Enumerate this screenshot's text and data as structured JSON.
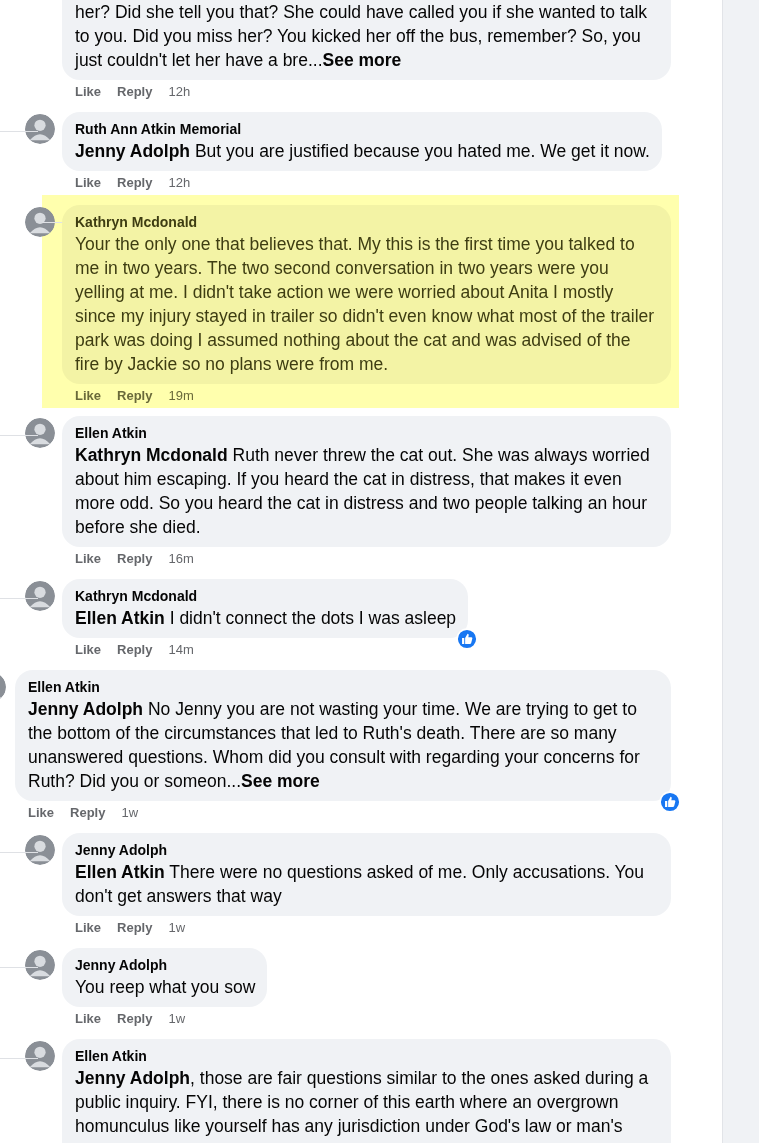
{
  "earlier_replies": [
    {
      "kind": "partial",
      "text": "her? Did she tell you that? She could have called you if she wanted to talk to you. Did you miss her? You kicked her off the bus, remember? So, you just couldn't let her have a bre...",
      "see_more": "See more",
      "like": "Like",
      "reply": "Reply",
      "time": "12h",
      "highlighted": false,
      "reacted": false
    },
    {
      "kind": "full",
      "author": "Ruth Ann Atkin Memorial",
      "text": "**Jenny Adolph** But you are justified because you hated me. We get it now.",
      "like": "Like",
      "reply": "Reply",
      "time": "12h",
      "highlighted": false,
      "reacted": false
    },
    {
      "kind": "full",
      "author": "Kathryn Mcdonald",
      "text": "Your the only one that believes that. My this is the first time you talked to me in two years. The two second conversation in two years were you yelling at me. I didn't take action we were worried about Anita I mostly since my injury stayed in trailer so didn't even know what most of the trailer park was doing I assumed nothing about the cat and was advised of the fire by Jackie so no plans were from me.",
      "like": "Like",
      "reply": "Reply",
      "time": "19m",
      "highlighted": true,
      "reacted": false
    },
    {
      "kind": "full",
      "author": "Ellen Atkin",
      "text": "**Kathryn Mcdonald** Ruth never threw the cat out. She was always worried about him escaping. If you heard the cat in distress, that makes it even more odd. So you heard the cat in distress and two people talking an hour before she died.",
      "like": "Like",
      "reply": "Reply",
      "time": "16m",
      "highlighted": false,
      "reacted": false
    },
    {
      "kind": "full",
      "author": "Kathryn Mcdonald",
      "text": "**Ellen Atkin** I didn't connect the dots I was asleep",
      "like": "Like",
      "reply": "Reply",
      "time": "14m",
      "highlighted": false,
      "reacted": true
    }
  ],
  "comment": {
    "kind": "full",
    "author": "Ellen Atkin",
    "text": "**Jenny Adolph** No Jenny you are not wasting your time. We are trying to get to the bottom of the circumstances that led to Ruth's death. There are so many unanswered questions. Whom did you consult with regarding your concerns for Ruth? Did you or someon...",
    "see_more": "See more",
    "like": "Like",
    "reply": "Reply",
    "time": "1w",
    "highlighted": false,
    "reacted": true,
    "children": [
      {
        "kind": "full",
        "author": "Jenny Adolph",
        "text": "**Ellen Atkin** There were no questions asked of me. Only accusations. You don't get answers that way",
        "like": "Like",
        "reply": "Reply",
        "time": "1w",
        "highlighted": false,
        "reacted": false
      },
      {
        "kind": "full",
        "author": "Jenny Adolph",
        "text": "You reep what you sow",
        "like": "Like",
        "reply": "Reply",
        "time": "1w",
        "highlighted": false,
        "reacted": false
      },
      {
        "kind": "cut",
        "author": "Ellen Atkin",
        "text": "**Jenny Adolph**, those are fair questions similar to the ones asked during a public inquiry. FYI, there is no corner of this earth where an overgrown homunculus like yourself has any jurisdiction under God's law or man's",
        "highlighted": false,
        "reacted": false
      }
    ]
  }
}
